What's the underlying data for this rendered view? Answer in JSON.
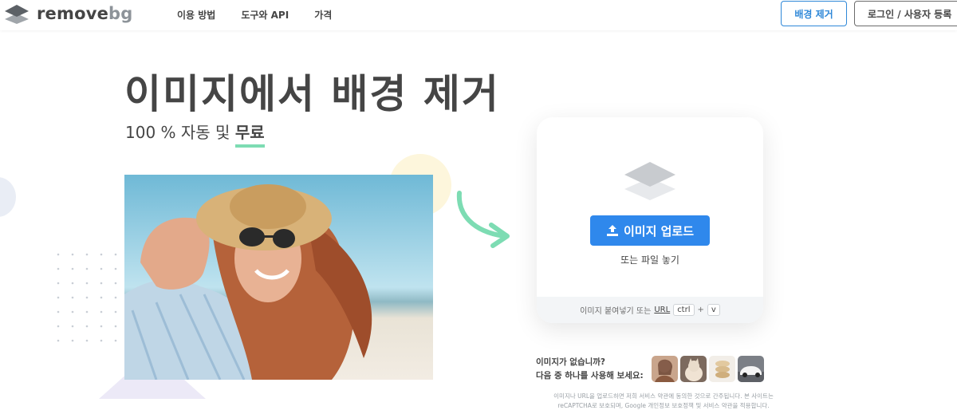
{
  "header": {
    "logo_text_main": "remove",
    "logo_text_accent": "bg",
    "logo_icon": "layers-icon",
    "nav": [
      {
        "label": "이용 방법"
      },
      {
        "label": "도구와 API"
      },
      {
        "label": "가격"
      }
    ],
    "remove_bg_button": "배경 제거",
    "login_button": "로그인 / 사용자 등록"
  },
  "hero": {
    "title": "이미지에서 배경 제거",
    "subtitle_prefix": "100 % 자동 및 ",
    "subtitle_highlight": "무료"
  },
  "upload": {
    "icon": "layers-icon",
    "button_label": "이미지 업로드",
    "button_icon": "upload-icon",
    "drop_text": "또는 파일 놓기",
    "paste_prefix": "이미지 붙여넣기 또는",
    "paste_url": "URL",
    "key_ctrl": "ctrl",
    "key_plus": "+",
    "key_v": "v"
  },
  "samples": {
    "line1": "이미지가 없습니까?",
    "line2": "다음 중 하나를 사용해 보세요:"
  },
  "legal": {
    "line1": "이미지나 URL을 업로드하면 저희 서비스 약관에 동의한 것으로 간주됩니다. 본 사이트는",
    "line2": "reCAPTCHA로 보호되며, Google 개인정보 보호정책 및 서비스 약관을 적용합니다."
  },
  "colors": {
    "accent_blue": "#2f88ec",
    "text_dark": "#454545",
    "highlight_green": "#7ddcb3",
    "arrow_green": "#7ddcb3"
  }
}
